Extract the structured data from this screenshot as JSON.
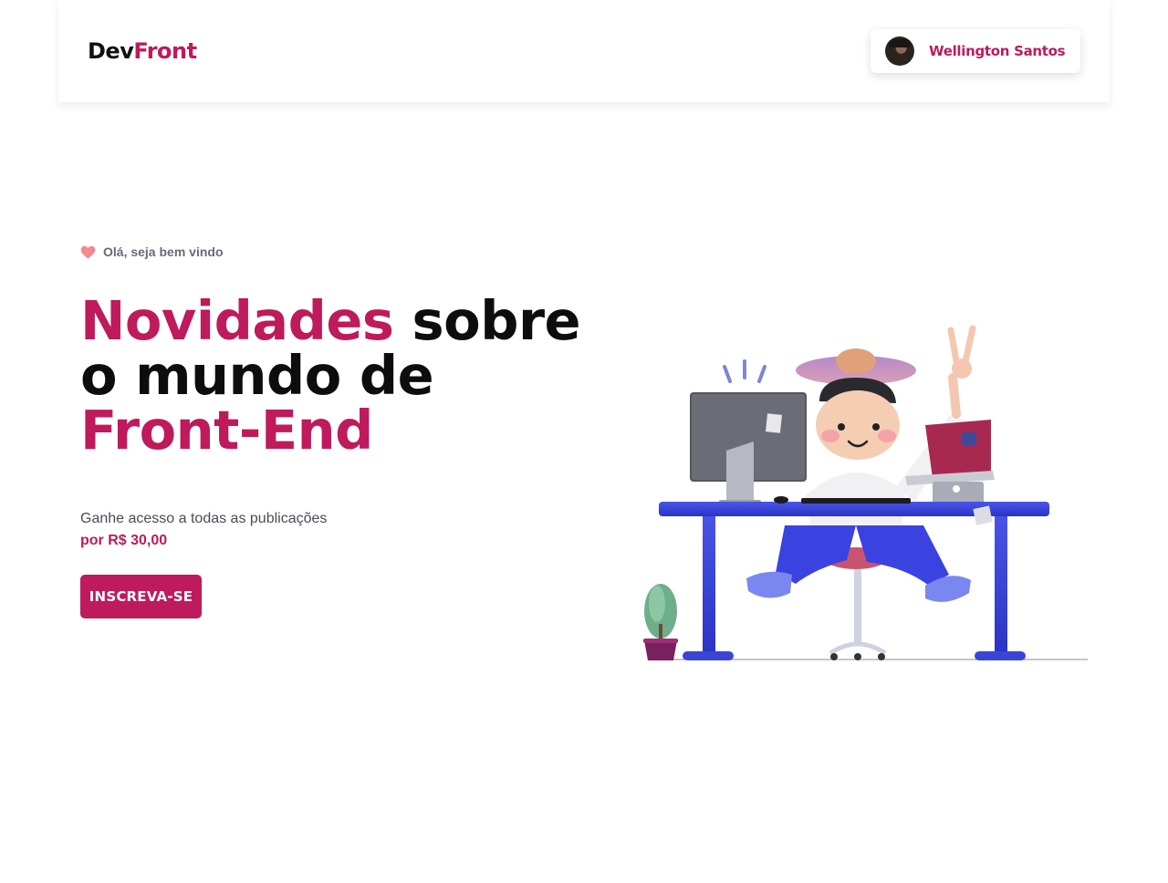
{
  "header": {
    "logo_part1": "Dev",
    "logo_part2": "Front",
    "user_name": "Wellington Santos"
  },
  "hero": {
    "welcome": "Olá, seja bem vindo",
    "headline_accent_1": "Novidades",
    "headline_rest_1": " sobre",
    "headline_line_2": "o mundo de",
    "headline_accent_3": "Front-End",
    "subtitle": "Ganhe acesso a todas as publicações",
    "price": "por R$ 30,00",
    "cta_label": "INSCREVA-SE"
  },
  "colors": {
    "accent": "#be1a5c",
    "text": "#0d0d0d",
    "muted": "#6b6b78"
  },
  "icons": {
    "welcome": "heart-icon",
    "illustration": "developer-at-desk-illustration"
  }
}
